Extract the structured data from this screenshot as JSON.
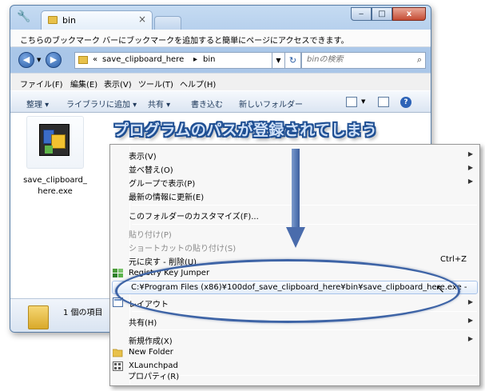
{
  "window": {
    "tab_title": "bin",
    "tab_close": "×",
    "controls": {
      "minimize": "‒",
      "maximize": "□",
      "close": "x"
    }
  },
  "bookmark_bar": {
    "text": "こちらのブックマーク バーにブックマークを追加すると簡単にページにアクセスできます。"
  },
  "address": {
    "crumb_sep": "«",
    "crumb1": "save_clipboard_here",
    "crumb_arrow": "▸",
    "crumb2": "bin",
    "search_placeholder": "binの検索"
  },
  "menubar": [
    "ファイル(F)",
    "編集(E)",
    "表示(V)",
    "ツール(T)",
    "ヘルプ(H)"
  ],
  "cmdbar": {
    "organize": "整理 ▾",
    "library": "ライブラリに追加 ▾",
    "share": "共有 ▾",
    "burn": "書き込む",
    "new_folder": "新しいフォルダー"
  },
  "files": [
    {
      "name": "save_clipboard_\nhere.exe",
      "line1": "save_clipboard_",
      "line2": "here.exe"
    }
  ],
  "status": {
    "count": "1 個の項目"
  },
  "overlay_caption": "プログラムのパスが登録されてしまう",
  "context_menu": {
    "items": [
      {
        "label": "表示(V)",
        "submenu": true,
        "disabled": false
      },
      {
        "label": "並べ替え(O)",
        "submenu": true,
        "disabled": false
      },
      {
        "label": "グループで表示(P)",
        "submenu": true,
        "disabled": false
      },
      {
        "label": "最新の情報に更新(E)",
        "submenu": false,
        "disabled": false
      },
      {
        "label": "このフォルダーのカスタマイズ(F)...",
        "submenu": false,
        "disabled": false
      },
      {
        "label": "貼り付け(P)",
        "submenu": false,
        "disabled": true
      },
      {
        "label": "ショートカットの貼り付け(S)",
        "submenu": false,
        "disabled": true
      },
      {
        "label": "元に戻す - 削除(U)",
        "shortcut": "Ctrl+Z",
        "submenu": false,
        "disabled": false
      },
      {
        "label": "Registry Key Jumper",
        "submenu": false,
        "disabled": false
      },
      {
        "label": "C:¥Program Files (x86)¥100dof_save_clipboard_here¥bin¥save_clipboard_here.exe -",
        "submenu": false,
        "disabled": false
      },
      {
        "label": "レイアウト",
        "submenu": true,
        "disabled": false
      },
      {
        "label": "共有(H)",
        "submenu": true,
        "disabled": false
      },
      {
        "label": "新規作成(X)",
        "submenu": true,
        "disabled": false
      },
      {
        "label": "New Folder",
        "submenu": false,
        "disabled": false
      },
      {
        "label": "XLaunchpad",
        "submenu": false,
        "disabled": false
      },
      {
        "label": "プロパティ(R)",
        "submenu": false,
        "disabled": false
      }
    ],
    "arrow_glyph": "▶"
  },
  "colors": {
    "annotation_blue": "#3e64a6",
    "caption_fill": "#cfe0f7",
    "caption_outline": "#1f4f93"
  }
}
